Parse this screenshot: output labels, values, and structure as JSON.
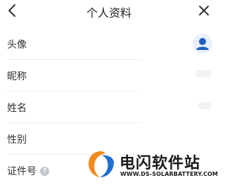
{
  "header": {
    "title": "个人资料",
    "back_icon": "chevron-left-icon",
    "close_icon": "close-icon"
  },
  "rows": [
    {
      "label": "头像",
      "value_type": "avatar",
      "icon": "user-avatar-icon"
    },
    {
      "label": "昵称"
    },
    {
      "label": "姓名"
    },
    {
      "label": "性别"
    },
    {
      "label": "证件号",
      "help_icon": "question-icon",
      "help_text": "?"
    }
  ],
  "watermark": {
    "title": "电闪软件站",
    "url": "WWW.DS-SOLARBATTERY.COM"
  },
  "colors": {
    "text": "#333333",
    "avatar_bg": "#e9f0fa",
    "avatar_fg": "#1e5fc2",
    "divider": "#eeeeee",
    "logo_orange": "#f28a1e",
    "logo_blue": "#1e6fd0"
  }
}
